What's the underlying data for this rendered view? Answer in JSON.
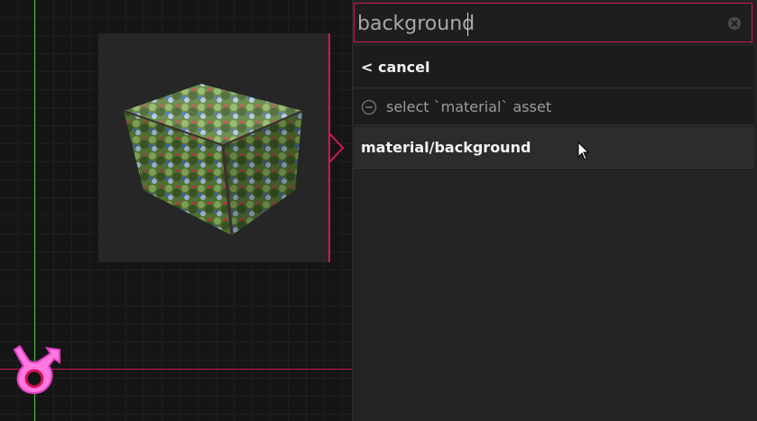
{
  "search": {
    "value": "background",
    "clear_icon": "clear-circle-icon"
  },
  "results": {
    "cancel_label": "< cancel",
    "select_hint": "select `material` asset",
    "select_hint_icon": "minus-circle-icon",
    "items": [
      {
        "label": "material/background"
      }
    ]
  },
  "viewport": {
    "preview_subject": "textured-cube",
    "gizmo_icon": "origin-gizmo-icon"
  },
  "colors": {
    "accent": "#d4145a",
    "axis_y": "#4fc33b",
    "gizmo": "#ff79e0"
  }
}
